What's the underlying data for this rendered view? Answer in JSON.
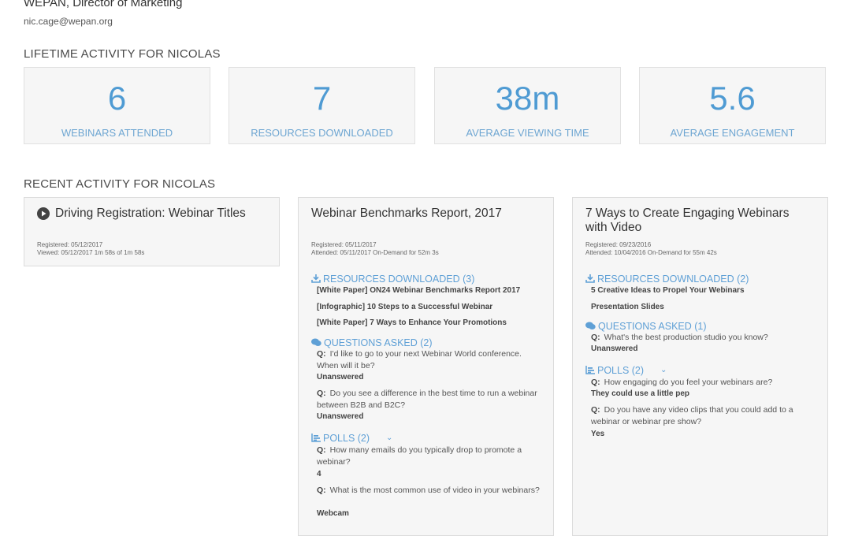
{
  "profile": {
    "org_title": "WEPAN, Director of Marketing",
    "email": "nic.cage@wepan.org"
  },
  "lifetime": {
    "heading": "LIFETIME ACTIVITY FOR NICOLAS",
    "stats": [
      {
        "value": "6",
        "label": "WEBINARS ATTENDED"
      },
      {
        "value": "7",
        "label": "RESOURCES DOWNLOADED"
      },
      {
        "value": "38m",
        "label": "AVERAGE VIEWING TIME"
      },
      {
        "value": "5.6",
        "label": "AVERAGE ENGAGEMENT"
      }
    ]
  },
  "recent": {
    "heading": "RECENT ACTIVITY FOR NICOLAS",
    "cards": [
      {
        "title": "Driving Registration: Webinar Titles",
        "meta1": "Registered:  05/12/2017",
        "meta2": "Viewed:  05/12/2017  1m 58s of 1m 58s"
      },
      {
        "title": "Webinar Benchmarks Report, 2017",
        "meta1": "Registered:  05/11/2017",
        "meta2": "Attended:  05/11/2017  On-Demand for 52m 3s",
        "resources_head": "RESOURCES DOWNLOADED (3)",
        "resources": [
          "[White Paper] ON24 Webinar Benchmarks Report 2017",
          "[Infographic] 10 Steps to a Successful Webinar",
          "[White Paper] 7 Ways to Enhance Your Promotions"
        ],
        "questions_head": "QUESTIONS ASKED (2)",
        "questions": [
          {
            "q": "Q:",
            "text": "I'd like to go to your next Webinar World conference. When will it be?",
            "answer": "Unanswered"
          },
          {
            "q": "Q:",
            "text": "Do you see a difference in the best time to run a webinar between B2B and B2C?",
            "answer": "Unanswered"
          }
        ],
        "polls_head": "POLLS (2)",
        "polls": [
          {
            "q": "Q:",
            "text": "How many emails do you typically drop to promote a webinar?",
            "answer": "4"
          },
          {
            "q": "Q:",
            "text": "What is the most common use of video in your webinars?",
            "answer": "Webcam"
          }
        ]
      },
      {
        "title": "7 Ways to Create Engaging Webinars with Video",
        "meta1": "Registered:  09/23/2016",
        "meta2": "Attended:  10/04/2016  On-Demand for 55m 42s",
        "resources_head": "RESOURCES DOWNLOADED (2)",
        "resources": [
          "5 Creative Ideas to Propel Your Webinars",
          "Presentation Slides"
        ],
        "questions_head": "QUESTIONS ASKED (1)",
        "questions": [
          {
            "q": "Q:",
            "text": "What's the best production studio you know?",
            "answer": "Unanswered"
          }
        ],
        "polls_head": "POLLS (2)",
        "polls": [
          {
            "q": "Q:",
            "text": "How engaging do you feel your webinars are?",
            "answer": "They could use a little pep"
          },
          {
            "q": "Q:",
            "text": "Do you have any video clips that you could add to a webinar or webinar pre show?",
            "answer": "Yes"
          }
        ]
      }
    ]
  },
  "icons": {
    "play": "play-circle-icon",
    "download": "download-icon",
    "chat": "chat-bubbles-icon",
    "poll": "bar-chart-icon",
    "chevron": "chevron-down-icon"
  },
  "colors": {
    "accent": "#4f9bd3",
    "accent_light": "#6ea6d2",
    "card_bg": "#f6f6f6",
    "border": "#dcdcdc"
  }
}
